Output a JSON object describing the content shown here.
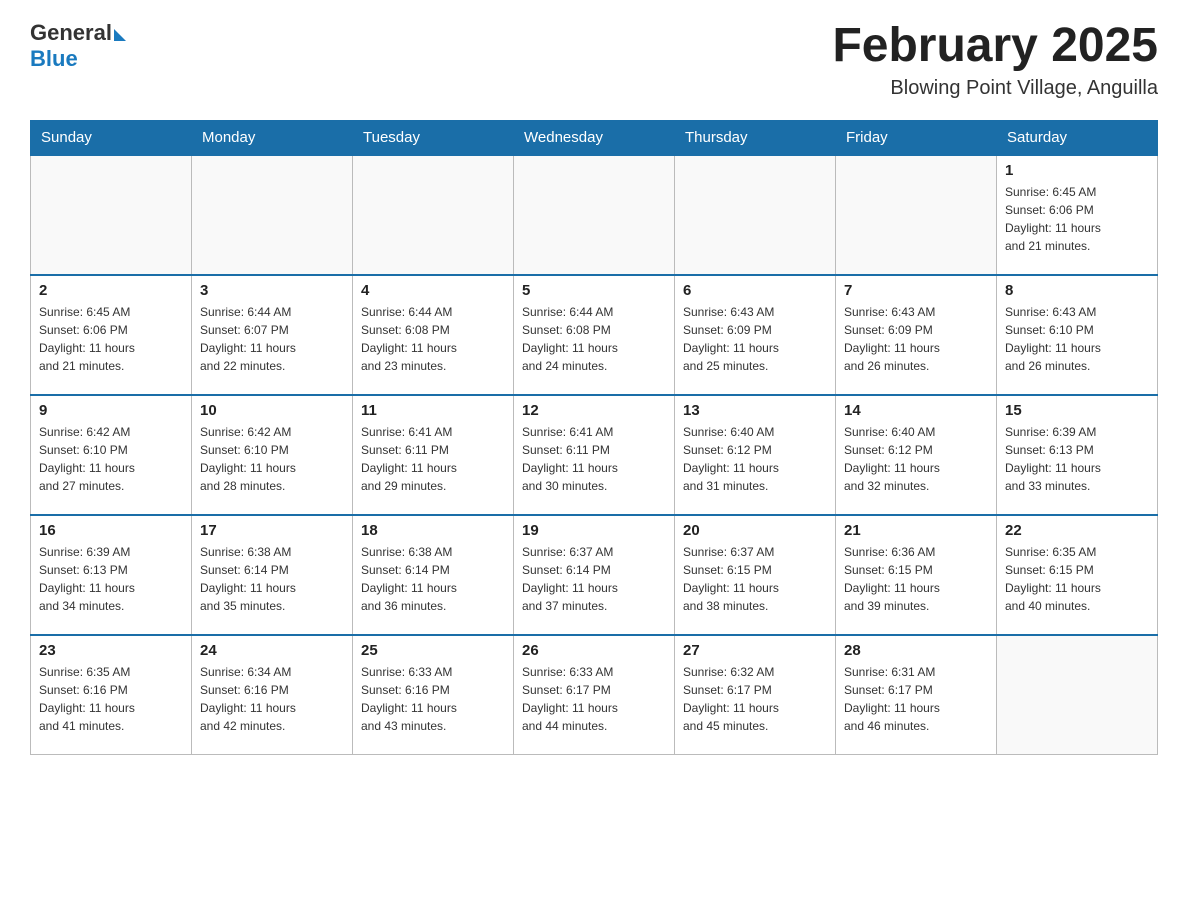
{
  "header": {
    "logo_general": "General",
    "logo_blue": "Blue",
    "month_title": "February 2025",
    "location": "Blowing Point Village, Anguilla"
  },
  "days_of_week": [
    "Sunday",
    "Monday",
    "Tuesday",
    "Wednesday",
    "Thursday",
    "Friday",
    "Saturday"
  ],
  "weeks": [
    [
      {
        "day": "",
        "info": ""
      },
      {
        "day": "",
        "info": ""
      },
      {
        "day": "",
        "info": ""
      },
      {
        "day": "",
        "info": ""
      },
      {
        "day": "",
        "info": ""
      },
      {
        "day": "",
        "info": ""
      },
      {
        "day": "1",
        "info": "Sunrise: 6:45 AM\nSunset: 6:06 PM\nDaylight: 11 hours\nand 21 minutes."
      }
    ],
    [
      {
        "day": "2",
        "info": "Sunrise: 6:45 AM\nSunset: 6:06 PM\nDaylight: 11 hours\nand 21 minutes."
      },
      {
        "day": "3",
        "info": "Sunrise: 6:44 AM\nSunset: 6:07 PM\nDaylight: 11 hours\nand 22 minutes."
      },
      {
        "day": "4",
        "info": "Sunrise: 6:44 AM\nSunset: 6:08 PM\nDaylight: 11 hours\nand 23 minutes."
      },
      {
        "day": "5",
        "info": "Sunrise: 6:44 AM\nSunset: 6:08 PM\nDaylight: 11 hours\nand 24 minutes."
      },
      {
        "day": "6",
        "info": "Sunrise: 6:43 AM\nSunset: 6:09 PM\nDaylight: 11 hours\nand 25 minutes."
      },
      {
        "day": "7",
        "info": "Sunrise: 6:43 AM\nSunset: 6:09 PM\nDaylight: 11 hours\nand 26 minutes."
      },
      {
        "day": "8",
        "info": "Sunrise: 6:43 AM\nSunset: 6:10 PM\nDaylight: 11 hours\nand 26 minutes."
      }
    ],
    [
      {
        "day": "9",
        "info": "Sunrise: 6:42 AM\nSunset: 6:10 PM\nDaylight: 11 hours\nand 27 minutes."
      },
      {
        "day": "10",
        "info": "Sunrise: 6:42 AM\nSunset: 6:10 PM\nDaylight: 11 hours\nand 28 minutes."
      },
      {
        "day": "11",
        "info": "Sunrise: 6:41 AM\nSunset: 6:11 PM\nDaylight: 11 hours\nand 29 minutes."
      },
      {
        "day": "12",
        "info": "Sunrise: 6:41 AM\nSunset: 6:11 PM\nDaylight: 11 hours\nand 30 minutes."
      },
      {
        "day": "13",
        "info": "Sunrise: 6:40 AM\nSunset: 6:12 PM\nDaylight: 11 hours\nand 31 minutes."
      },
      {
        "day": "14",
        "info": "Sunrise: 6:40 AM\nSunset: 6:12 PM\nDaylight: 11 hours\nand 32 minutes."
      },
      {
        "day": "15",
        "info": "Sunrise: 6:39 AM\nSunset: 6:13 PM\nDaylight: 11 hours\nand 33 minutes."
      }
    ],
    [
      {
        "day": "16",
        "info": "Sunrise: 6:39 AM\nSunset: 6:13 PM\nDaylight: 11 hours\nand 34 minutes."
      },
      {
        "day": "17",
        "info": "Sunrise: 6:38 AM\nSunset: 6:14 PM\nDaylight: 11 hours\nand 35 minutes."
      },
      {
        "day": "18",
        "info": "Sunrise: 6:38 AM\nSunset: 6:14 PM\nDaylight: 11 hours\nand 36 minutes."
      },
      {
        "day": "19",
        "info": "Sunrise: 6:37 AM\nSunset: 6:14 PM\nDaylight: 11 hours\nand 37 minutes."
      },
      {
        "day": "20",
        "info": "Sunrise: 6:37 AM\nSunset: 6:15 PM\nDaylight: 11 hours\nand 38 minutes."
      },
      {
        "day": "21",
        "info": "Sunrise: 6:36 AM\nSunset: 6:15 PM\nDaylight: 11 hours\nand 39 minutes."
      },
      {
        "day": "22",
        "info": "Sunrise: 6:35 AM\nSunset: 6:15 PM\nDaylight: 11 hours\nand 40 minutes."
      }
    ],
    [
      {
        "day": "23",
        "info": "Sunrise: 6:35 AM\nSunset: 6:16 PM\nDaylight: 11 hours\nand 41 minutes."
      },
      {
        "day": "24",
        "info": "Sunrise: 6:34 AM\nSunset: 6:16 PM\nDaylight: 11 hours\nand 42 minutes."
      },
      {
        "day": "25",
        "info": "Sunrise: 6:33 AM\nSunset: 6:16 PM\nDaylight: 11 hours\nand 43 minutes."
      },
      {
        "day": "26",
        "info": "Sunrise: 6:33 AM\nSunset: 6:17 PM\nDaylight: 11 hours\nand 44 minutes."
      },
      {
        "day": "27",
        "info": "Sunrise: 6:32 AM\nSunset: 6:17 PM\nDaylight: 11 hours\nand 45 minutes."
      },
      {
        "day": "28",
        "info": "Sunrise: 6:31 AM\nSunset: 6:17 PM\nDaylight: 11 hours\nand 46 minutes."
      },
      {
        "day": "",
        "info": ""
      }
    ]
  ]
}
